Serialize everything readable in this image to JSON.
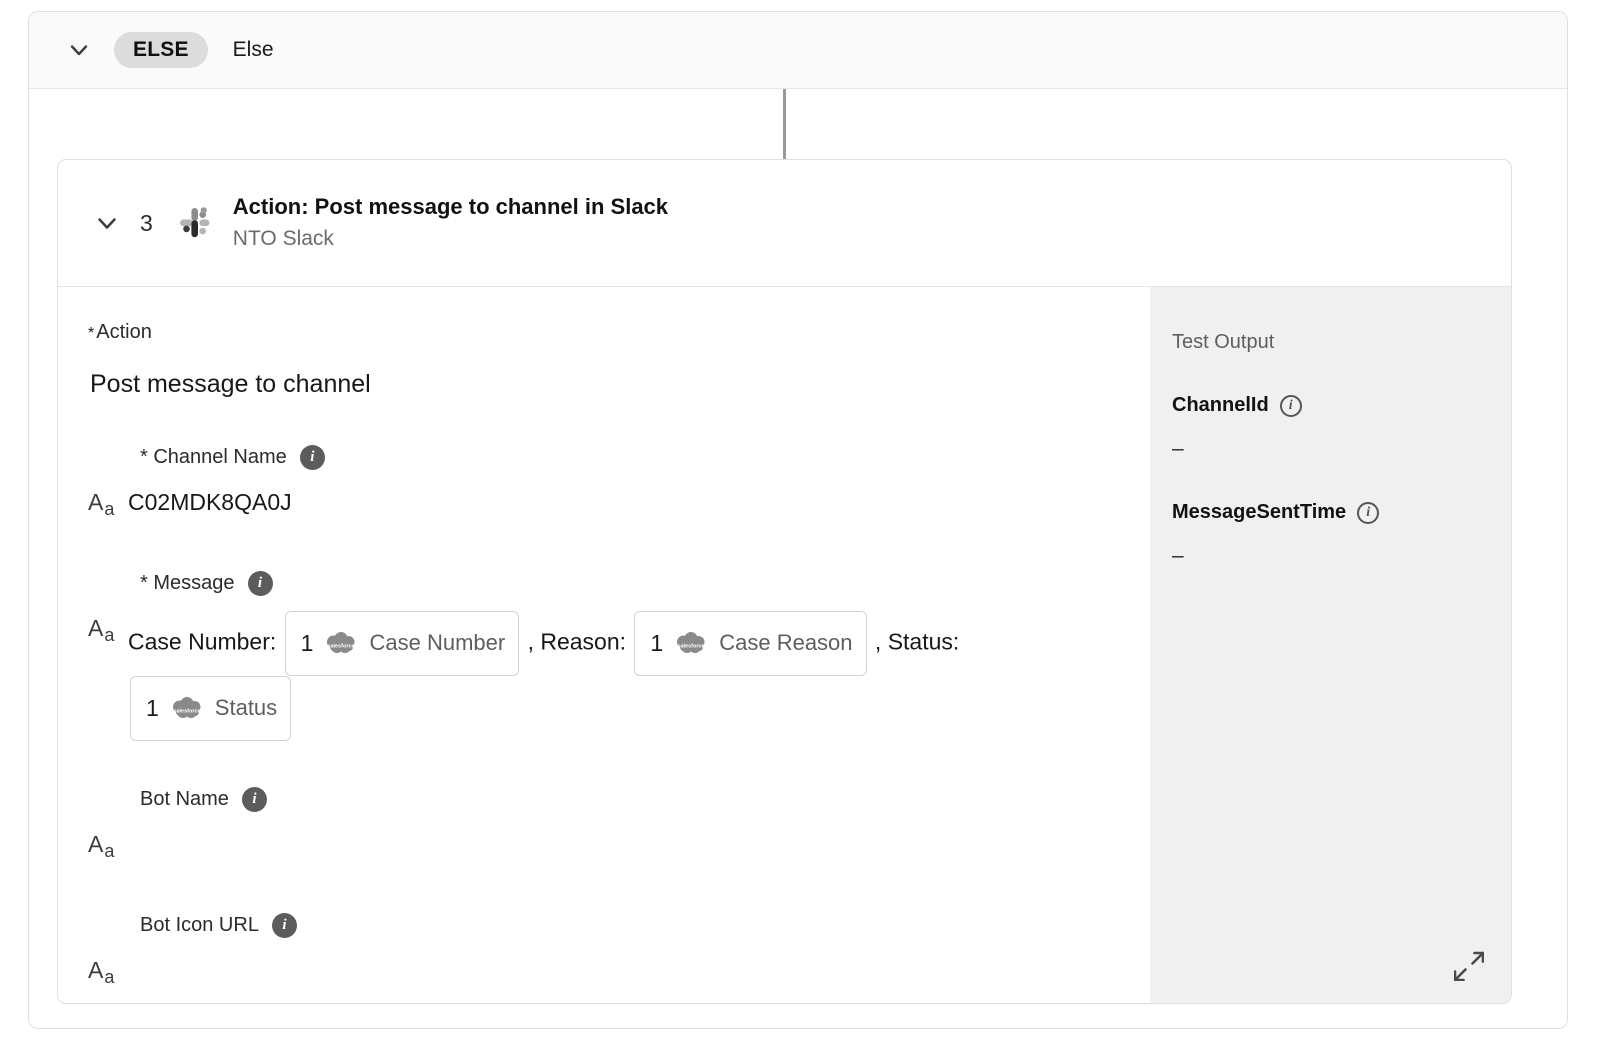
{
  "branch": {
    "badge": "ELSE",
    "label": "Else",
    "chevron_icon": "chevron-down-icon"
  },
  "action_step": {
    "number": "3",
    "chevron_icon": "chevron-down-icon",
    "app_icon": "slack-icon",
    "title": "Action: Post message to channel in Slack",
    "subtitle": "NTO Slack"
  },
  "form": {
    "action_field": {
      "required_marker": "*",
      "label": "Action",
      "value": "Post message to channel"
    },
    "fields": [
      {
        "required_marker": "*",
        "label": "Channel Name",
        "info_icon": "info-icon",
        "type_icon": "text-format-icon",
        "value": "C02MDK8QA0J"
      },
      {
        "required_marker": "*",
        "label": "Message",
        "info_icon": "info-icon",
        "type_icon": "text-format-icon",
        "segments": [
          {
            "kind": "text",
            "text": "Case Number:"
          },
          {
            "kind": "chip",
            "num": "1",
            "icon": "salesforce-cloud-icon",
            "name": "Case Number"
          },
          {
            "kind": "text",
            "text": ", Reason:"
          },
          {
            "kind": "chip",
            "num": "1",
            "icon": "salesforce-cloud-icon",
            "name": "Case Reason"
          },
          {
            "kind": "text",
            "text": ", Status:"
          },
          {
            "kind": "chip",
            "num": "1",
            "icon": "salesforce-cloud-icon",
            "name": "Status"
          }
        ]
      },
      {
        "required_marker": "",
        "label": "Bot Name",
        "info_icon": "info-icon",
        "type_icon": "text-format-icon",
        "value": ""
      },
      {
        "required_marker": "",
        "label": "Bot Icon URL",
        "info_icon": "info-icon",
        "type_icon": "text-format-icon",
        "value": ""
      }
    ]
  },
  "test_output": {
    "title": "Test Output",
    "expand_icon": "expand-icon",
    "fields": [
      {
        "name": "ChannelId",
        "info_icon": "info-icon",
        "value": "–"
      },
      {
        "name": "MessageSentTime",
        "info_icon": "info-icon",
        "value": "–"
      }
    ]
  },
  "colors": {
    "badge_bg": "#dcdcdc",
    "panel_bg": "#f0f0f0",
    "border": "#e0e0e0",
    "connector": "#999999",
    "muted_text": "#6b6b6b"
  }
}
